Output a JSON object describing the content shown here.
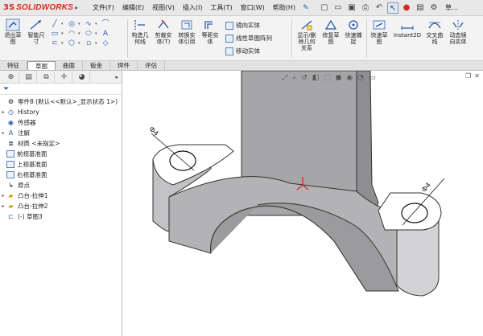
{
  "app": {
    "logo_mark": "3S",
    "logo_text": "SOLIDWORKS",
    "title": "草..."
  },
  "menu": [
    "文件(F)",
    "编辑(E)",
    "视图(V)",
    "插入(I)",
    "工具(T)",
    "窗口(W)",
    "帮助(H)"
  ],
  "ribbon": {
    "exit_sketch": "退出草\n图",
    "smart_dim": "智能尺\n寸",
    "construct_geo": "构造几\n何线",
    "trim": "剪裁实\n体(T)",
    "convert": "转换实\n体引用",
    "offset": "等距实\n体",
    "mirror": "镜向实体",
    "linear_pattern": "线性草图阵列",
    "move": "移动实体",
    "display_delete": "显示/删\n除几何\n关系",
    "repair": "修复草\n图",
    "quick_snap": "快速捕\n捉",
    "rapid_sketch": "快速草\n图",
    "instant2d": "Instant2D",
    "intersection_curve": "交叉曲\n线",
    "dynamic_mirror": "动态镜\n向实体"
  },
  "tabs": [
    "特征",
    "草图",
    "曲面",
    "钣金",
    "焊件",
    "评估"
  ],
  "active_tab": "草图",
  "tree": {
    "root": "零件8 (默认<<默认>_显示状态 1>)",
    "items": [
      {
        "label": "History",
        "icon": "history-icon",
        "expandable": true
      },
      {
        "label": "传感器",
        "icon": "sensor-icon",
        "expandable": false
      },
      {
        "label": "注解",
        "icon": "annotation-icon",
        "expandable": true
      },
      {
        "label": "材质 <未指定>",
        "icon": "material-icon",
        "expandable": false
      },
      {
        "label": "前视基准面",
        "icon": "plane-icon",
        "expandable": false
      },
      {
        "label": "上视基准面",
        "icon": "plane-icon",
        "expandable": false
      },
      {
        "label": "右视基准面",
        "icon": "plane-icon",
        "expandable": false
      },
      {
        "label": "原点",
        "icon": "origin-icon",
        "expandable": false
      },
      {
        "label": "凸台-拉伸1",
        "icon": "extrude-icon",
        "expandable": true
      },
      {
        "label": "凸台-拉伸2",
        "icon": "extrude-icon",
        "expandable": true
      },
      {
        "label": "(-) 草图3",
        "icon": "sketch-icon",
        "expandable": false
      }
    ]
  },
  "dims": {
    "left": "Φ4",
    "right": "Φ4"
  },
  "colors": {
    "part_face": "#a9a9ab",
    "part_top": "#ffffff",
    "accent": "#d52b1e",
    "sketch_blue": "#2a5aa8"
  }
}
